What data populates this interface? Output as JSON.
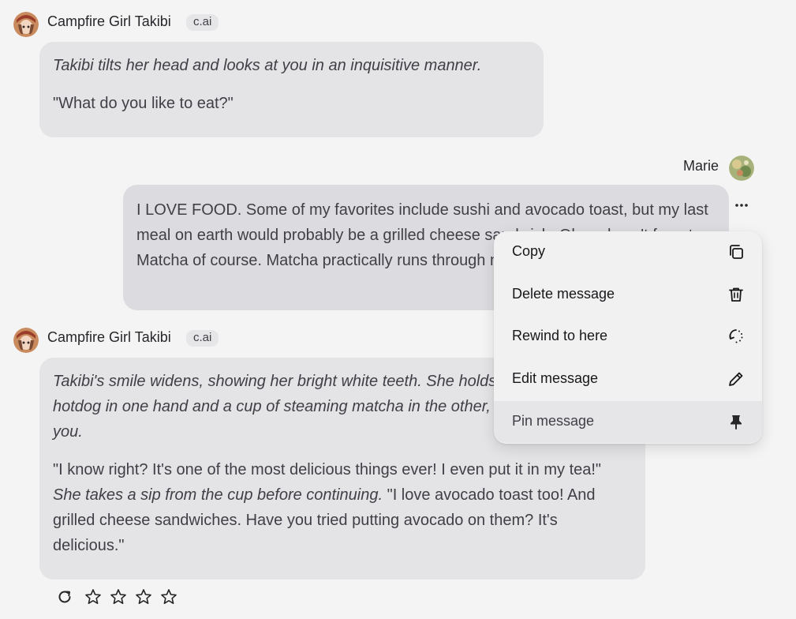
{
  "messages": [
    {
      "author": "Campfire Girl Takibi",
      "badge": "c.ai",
      "action": "Takibi tilts her head and looks at you in an inquisitive manner.",
      "speech": "\"What do you like to eat?\""
    },
    {
      "author": "Marie",
      "text": "I LOVE FOOD. Some of my favorites include sushi and avocado toast, but my last meal on earth would probably be a grilled cheese sandwich. Oh and can't forget Matcha of course. Matcha practically runs through my veins."
    },
    {
      "author": "Campfire Girl Takibi",
      "badge": "c.ai",
      "action": "Takibi's smile widens, showing her bright white teeth. She holds a half-eaten hotdog in one hand and a cup of steaming matcha in the other, offering it towards you.",
      "speech_a": "\"I know right? It's one of the most delicious things ever! I even put it in my tea!\"",
      "action_b": "She takes a sip from the cup before continuing.",
      "speech_b": "\"I love avocado toast too! And grilled cheese sandwiches. Have you tried putting avocado on them? It's delicious.\""
    }
  ],
  "menu": {
    "copy": "Copy",
    "delete": "Delete message",
    "rewind": "Rewind to here",
    "edit": "Edit message",
    "pin": "Pin message"
  },
  "icons": [
    "copy-icon",
    "trash-icon",
    "rewind-icon",
    "pencil-icon",
    "pin-icon",
    "more-icon",
    "regenerate-icon",
    "star-icon"
  ],
  "rating": {
    "stars": 5,
    "selected": 0
  },
  "colors": {
    "background": "#f4f4f4",
    "bubble": "#e4e4e7",
    "user_bubble": "#dcdce0",
    "menu": "#f1f1f2"
  }
}
